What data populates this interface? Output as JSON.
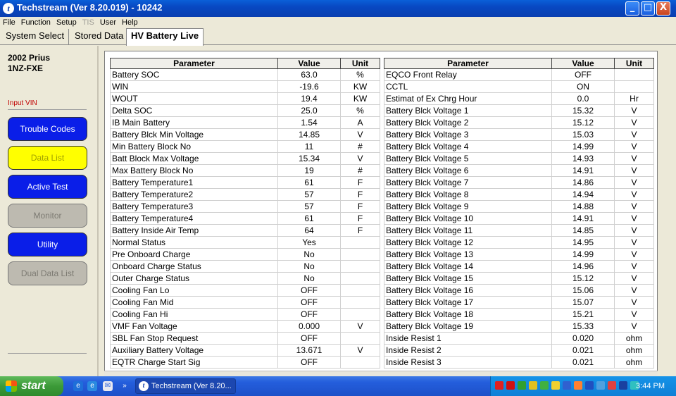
{
  "window": {
    "title": "Techstream (Ver 8.20.019) - 10242",
    "minimize": "_",
    "maximize": "□",
    "close": "X"
  },
  "menu": [
    "File",
    "Function",
    "Setup",
    "TIS",
    "User",
    "Help"
  ],
  "tabs": [
    "System Select",
    "Stored Data",
    "HV Battery Live"
  ],
  "vehicle": {
    "model": "2002 Prius",
    "engine": "1NZ-FXE"
  },
  "input_vin": "Input VIN",
  "side_buttons": {
    "trouble_codes": "Trouble Codes",
    "data_list": "Data List",
    "active_test": "Active Test",
    "monitor": "Monitor",
    "utility": "Utility",
    "dual_data_list": "Dual Data List"
  },
  "headers": {
    "parameter": "Parameter",
    "value": "Value",
    "unit": "Unit"
  },
  "left_rows": [
    [
      "Battery SOC",
      "63.0",
      "%"
    ],
    [
      "WIN",
      "-19.6",
      "KW"
    ],
    [
      "WOUT",
      "19.4",
      "KW"
    ],
    [
      "Delta SOC",
      "25.0",
      "%"
    ],
    [
      "IB Main Battery",
      "1.54",
      "A"
    ],
    [
      "Battery Blck Min Voltage",
      "14.85",
      "V"
    ],
    [
      "Min Battery Block No",
      "11",
      "#"
    ],
    [
      "Batt Block Max Voltage",
      "15.34",
      "V"
    ],
    [
      "Max Battery Block No",
      "19",
      "#"
    ],
    [
      "Battery Temperature1",
      "61",
      "F"
    ],
    [
      "Battery Temperature2",
      "57",
      "F"
    ],
    [
      "Battery Temperature3",
      "57",
      "F"
    ],
    [
      "Battery Temperature4",
      "61",
      "F"
    ],
    [
      "Battery Inside Air Temp",
      "64",
      "F"
    ],
    [
      "Normal Status",
      "Yes",
      ""
    ],
    [
      "Pre Onboard Charge",
      "No",
      ""
    ],
    [
      "Onboard Charge Status",
      "No",
      ""
    ],
    [
      "Outer Charge Status",
      "No",
      ""
    ],
    [
      "Cooling Fan Lo",
      "OFF",
      ""
    ],
    [
      "Cooling Fan Mid",
      "OFF",
      ""
    ],
    [
      "Cooling Fan Hi",
      "OFF",
      ""
    ],
    [
      "VMF Fan Voltage",
      "0.000",
      "V"
    ],
    [
      "SBL Fan Stop Request",
      "OFF",
      ""
    ],
    [
      "Auxiliary Battery Voltage",
      "13.671",
      "V"
    ],
    [
      "EQTR Charge Start Sig",
      "OFF",
      ""
    ]
  ],
  "right_rows": [
    [
      "EQCO Front Relay",
      "OFF",
      ""
    ],
    [
      "CCTL",
      "ON",
      ""
    ],
    [
      "Estimat of Ex Chrg Hour",
      "0.0",
      "Hr"
    ],
    [
      "Battery Blck Voltage 1",
      "15.32",
      "V"
    ],
    [
      "Battery Blck Voltage 2",
      "15.12",
      "V"
    ],
    [
      "Battery Blck Voltage 3",
      "15.03",
      "V"
    ],
    [
      "Battery Blck Voltage 4",
      "14.99",
      "V"
    ],
    [
      "Battery Blck Voltage 5",
      "14.93",
      "V"
    ],
    [
      "Battery Blck Voltage 6",
      "14.91",
      "V"
    ],
    [
      "Battery Blck Voltage 7",
      "14.86",
      "V"
    ],
    [
      "Battery Blck Voltage 8",
      "14.94",
      "V"
    ],
    [
      "Battery Blck Voltage 9",
      "14.88",
      "V"
    ],
    [
      "Battery Blck Voltage 10",
      "14.91",
      "V"
    ],
    [
      "Battery Blck Voltage 11",
      "14.85",
      "V"
    ],
    [
      "Battery Blck Voltage 12",
      "14.95",
      "V"
    ],
    [
      "Battery Blck Voltage 13",
      "14.99",
      "V"
    ],
    [
      "Battery Blck Voltage 14",
      "14.96",
      "V"
    ],
    [
      "Battery Blck Voltage 15",
      "15.12",
      "V"
    ],
    [
      "Battery Blck Voltage 16",
      "15.06",
      "V"
    ],
    [
      "Battery Blck Voltage 17",
      "15.07",
      "V"
    ],
    [
      "Battery Blck Voltage 18",
      "15.21",
      "V"
    ],
    [
      "Battery Blck Voltage 19",
      "15.33",
      "V"
    ],
    [
      "Inside Resist 1",
      "0.020",
      "ohm"
    ],
    [
      "Inside Resist 2",
      "0.021",
      "ohm"
    ],
    [
      "Inside Resist 3",
      "0.021",
      "ohm"
    ]
  ],
  "taskbar": {
    "start": "start",
    "task": "Techstream (Ver 8.20...",
    "clock": "3:44 PM"
  }
}
